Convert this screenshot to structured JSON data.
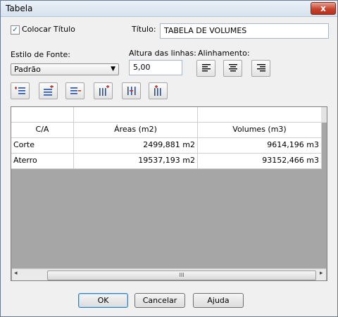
{
  "window": {
    "title": "Tabela",
    "close_glyph": "x"
  },
  "options": {
    "show_title_label": "Colocar Título",
    "show_title_checked": true,
    "title_label": "Título:",
    "title_value": "TABELA DE VOLUMES",
    "font_style_label": "Estilo de Fonte:",
    "font_style_value": "Padrão",
    "row_height_label": "Altura das linhas:",
    "row_height_value": "5,00",
    "alignment_label": "Alinhamento:"
  },
  "toolbar": {
    "icons": [
      "insert-row-icon",
      "insert-row-above-icon",
      "append-row-icon",
      "insert-column-icon",
      "delete-column-icon",
      "append-column-icon"
    ]
  },
  "table": {
    "columns": [
      "C/A",
      "Áreas (m2)",
      "Volumes (m3)"
    ],
    "rows": [
      [
        "Corte",
        "2499,881 m2",
        "9614,196 m3"
      ],
      [
        "Aterro",
        "19537,193 m2",
        "93152,466 m3"
      ]
    ],
    "scroll_thumb_glyph": "III"
  },
  "buttons": {
    "ok": "OK",
    "cancel": "Cancelar",
    "help": "Ajuda"
  },
  "colors": {
    "accent": "#1a5ca8",
    "grid_background": "#a6a6a6",
    "close": "#c7432c"
  }
}
